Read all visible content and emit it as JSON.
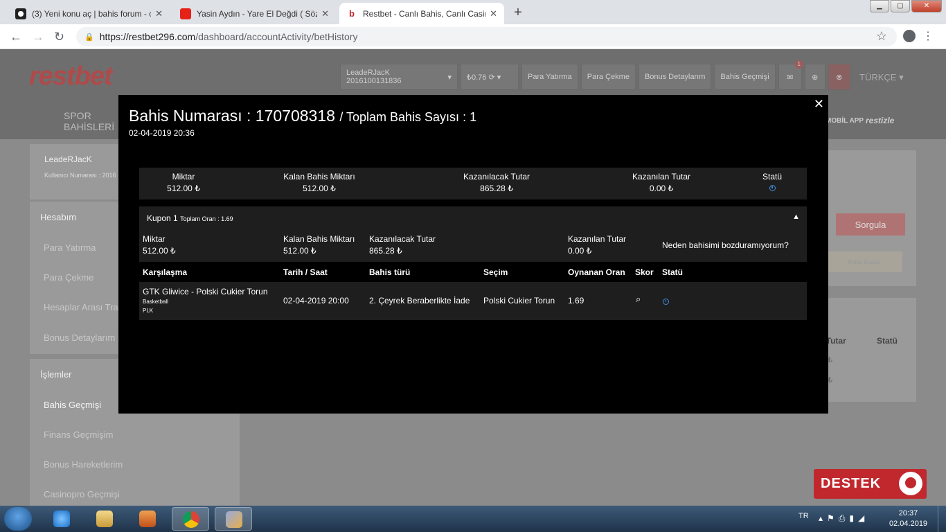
{
  "browser": {
    "tabs": [
      {
        "label": "(3) Yeni konu aç | bahis forum - ci",
        "favicon": "soccer-ball-icon",
        "active": false
      },
      {
        "label": "Yasin Aydın - Yare El Değdi ( Söz",
        "favicon": "youtube-icon",
        "active": false
      },
      {
        "label": "Restbet - Canlı Bahis, Canlı Casino",
        "favicon": "restbet-icon",
        "active": true
      }
    ],
    "new_tab": "+",
    "url_host": "https://restbet296.com",
    "url_path": "/dashboard/accountActivity/betHistory",
    "window_controls": [
      "minimize",
      "maximize",
      "close"
    ]
  },
  "site": {
    "logo": "restbet",
    "nav": {
      "account": "LeadeRJacK 2016100131836",
      "balance": "₺0.76",
      "deposit": "Para Yatırma",
      "withdraw": "Para Çekme",
      "bonus": "Bonus Detaylarım",
      "history": "Bahis Geçmişi",
      "notification_count": "1",
      "language": "TÜRKÇE"
    },
    "spor_line1": "SPOR",
    "spor_line2": "BAHİSLERİ",
    "mobil_app": "MOBİL APP",
    "restizle": "restizle",
    "user": {
      "name": "LeadeRJacK",
      "number_label": "Kullanıcı Numarası : 2016"
    },
    "sidebar_hesabim": {
      "title": "Hesabım",
      "items": [
        "Para Yatırma",
        "Para Çekme",
        "Hesaplar Arası Tra",
        "Bonus Detaylarım"
      ]
    },
    "sidebar_islemler": {
      "title": "İşlemler",
      "items": [
        "Bahis Geçmişi",
        "Finans Geçmişim",
        "Bonus Hareketlerim",
        "Casinopro Geçmişi"
      ]
    },
    "right": {
      "sorgula": "Sorgula",
      "bahis_bozdur": "Bahis Bozdur",
      "col_tutar": "n Tutar",
      "col_statu": "Statü",
      "row1_amount": "0 ₺",
      "row2_amount": "0 ₺"
    },
    "destek": "DESTEK"
  },
  "modal": {
    "title": "Bahis Numarası : 170708318",
    "subtitle": "/ Toplam Bahis Sayısı : 1",
    "date": "02-04-2019 20:36",
    "summary": {
      "miktar_label": "Miktar",
      "miktar": "512.00 ₺",
      "kalan_label": "Kalan Bahis Miktarı",
      "kalan": "512.00 ₺",
      "kazanilacak_label": "Kazanılacak Tutar",
      "kazanilacak": "865.28 ₺",
      "kazanilan_label": "Kazanılan Tutar",
      "kazanilan": "0.00 ₺",
      "statu_label": "Statü"
    },
    "coupon": {
      "title": "Kupon 1",
      "odds_label": "Toplam Oran : 1.69",
      "miktar_label": "Miktar",
      "miktar": "512.00 ₺",
      "kalan_label": "Kalan Bahis Miktarı",
      "kalan": "512.00 ₺",
      "kazanilacak_label": "Kazanılacak Tutar",
      "kazanilacak": "865.28 ₺",
      "kazanilan_label": "Kazanılan Tutar",
      "kazanilan": "0.00 ₺",
      "why": "Neden bahisimi bozduramıyorum?"
    },
    "table": {
      "headers": [
        "Karşılaşma",
        "Tarih / Saat",
        "Bahis türü",
        "Seçim",
        "Oynanan Oran",
        "Skor",
        "Statü"
      ],
      "row": {
        "match": "GTK Gliwice - Polski Cukier Torun",
        "sport": "Basketball",
        "league": "PLK",
        "datetime": "02-04-2019 20:00",
        "bet_type": "2. Çeyrek Beraberlikte İade",
        "selection": "Polski Cukier Torun",
        "odds": "1.69"
      }
    }
  },
  "taskbar": {
    "apps": [
      "internet-explorer-icon",
      "file-explorer-icon",
      "media-player-icon",
      "chrome-icon",
      "paint-icon"
    ],
    "language": "TR",
    "time": "20:37",
    "date": "02.04.2019"
  },
  "colors": {
    "brand_red": "#c0282d",
    "status_blue": "#3f8fe0",
    "modal_bg": "#000000",
    "row_bg": "#1e1e1e"
  }
}
